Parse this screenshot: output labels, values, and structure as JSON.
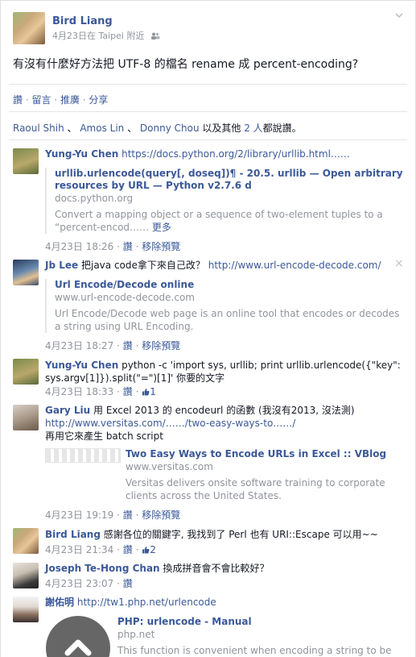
{
  "post": {
    "author": "Bird Liang",
    "meta": "4月23日在 Taipei 附近",
    "text": "有沒有什麼好方法把 UTF-8 的檔名 rename 成 percent-encoding?",
    "actions": [
      "讚",
      "留言",
      "推廣",
      "分享"
    ],
    "likes": {
      "names": [
        "Raoul Shih",
        "Amos Lin",
        "Donny Chou"
      ],
      "others_text": "以及其他",
      "others_count": "2 人",
      "suffix": "都說讚。"
    }
  },
  "comments": [
    {
      "author": "Yung-Yu Chen",
      "text": "https://docs.python.org/2/library/urllib.html……",
      "share": {
        "title": "urllib.urlencode(query[, doseq])¶ - 20.5. urllib — Open arbitrary resources by URL — Python v2.7.6 d",
        "domain": "docs.python.org",
        "desc": "Convert a mapping object or a sequence of two-element tuples to a “percent-encod……",
        "more": "更多"
      },
      "time": "4月23日 18:26",
      "like": "讚",
      "remove": "移除預覽"
    },
    {
      "author": "Jb Lee",
      "text": "把java code拿下來自己改？",
      "url": "http://www.url-encode-decode.com/",
      "share": {
        "title": "Url Encode/Decode online",
        "domain": "www.url-encode-decode.com",
        "desc": "Url Encode/Decode web page is an online tool that encodes or decodes a string using URL Encoding."
      },
      "time": "4月23日 18:27",
      "like": "讚",
      "remove": "移除預覽",
      "close": "×"
    },
    {
      "author": "Yung-Yu Chen",
      "text": "python -c 'import sys, urllib; print urllib.urlencode({\"key\": sys.argv[1]}).split(\"=\")[1]' 你要的文字",
      "time": "4月23日 18:33",
      "like": "讚",
      "like_count": "1"
    },
    {
      "author": "Gary Liu",
      "text": "用 Excel 2013 的 encodeurl 的函數 (我沒有2013, 沒法測)",
      "url": "http://www.versitas.com/……/two-easy-ways-to……/",
      "text2": "再用它來產生 batch script",
      "share": {
        "title": "Two Easy Ways to Encode URLs in Excel :: VBlog",
        "domain": "www.versitas.com",
        "desc": "Versitas delivers onsite software training to corporate clients across the United States."
      },
      "time": "4月23日 19:19",
      "like": "讚",
      "remove": "移除預覽"
    },
    {
      "author": "Bird Liang",
      "text": "感謝各位的關鍵字, 我找到了 Perl 也有 URI::Escape 可以用~~",
      "time": "4月23日 21:34",
      "like": "讚",
      "like_count": "2"
    },
    {
      "author": "Joseph Te-Hong Chan",
      "text": "換成拼音會不會比較好？",
      "time": "4月23日 23:07",
      "like": "讚"
    },
    {
      "author": "謝佑明",
      "url": "http://tw1.php.net/urlencode",
      "share": {
        "title": "PHP: urlencode - Manual",
        "domain": "php.net",
        "desc": "This function is convenient when encoding a string to be used"
      }
    }
  ],
  "separator": " · ",
  "name_separator": " 、 ",
  "colors": {
    "link": "#3b5998",
    "meta": "#90949c",
    "text": "#141823"
  }
}
